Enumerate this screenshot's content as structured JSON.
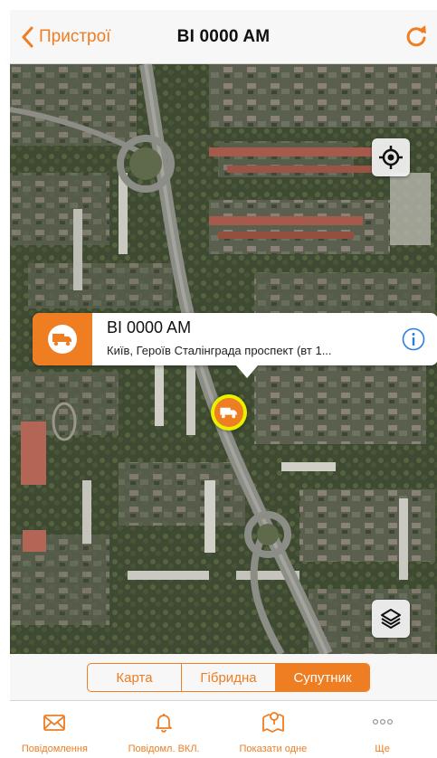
{
  "nav": {
    "back_label": "Пристрої",
    "title": "BI 0000 AM"
  },
  "callout": {
    "title": "BI 0000 AM",
    "address": "Київ, Героїв Сталінграда проспект (вт 1..."
  },
  "map_type": {
    "options": [
      "Карта",
      "Гібридна",
      "Супутник"
    ],
    "selected": "Супутник"
  },
  "tabs": [
    {
      "label": "Повідомлення",
      "icon": "envelope-icon"
    },
    {
      "label": "Повідомл. ВКЛ.",
      "icon": "bell-icon"
    },
    {
      "label": "Показати одне",
      "icon": "map-pin-icon"
    },
    {
      "label": "Ще",
      "icon": "more-dots-icon"
    }
  ],
  "colors": {
    "accent": "#ef7d22",
    "marker_ring": "#e8f000"
  }
}
